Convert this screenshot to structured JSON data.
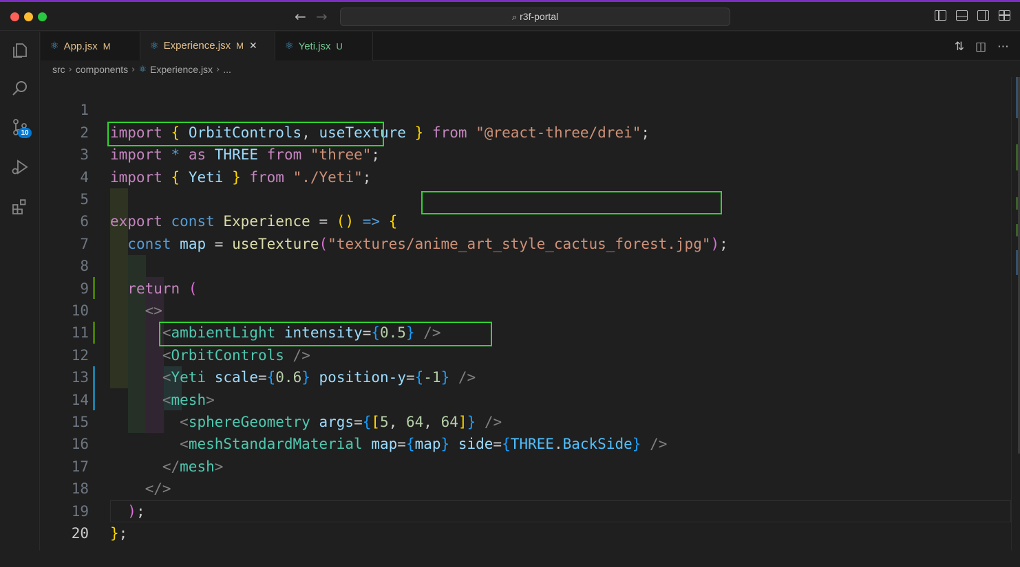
{
  "window": {
    "title": "r3f-portal"
  },
  "activity_bar": {
    "items": [
      "explorer-icon",
      "search-icon",
      "source-control-icon",
      "run-debug-icon",
      "extensions-icon"
    ],
    "source_control_badge": "10"
  },
  "tabs": [
    {
      "label": "App.jsx",
      "status": "M"
    },
    {
      "label": "Experience.jsx",
      "status": "M",
      "close": "✕"
    },
    {
      "label": "Yeti.jsx",
      "status": "U"
    }
  ],
  "breadcrumbs": {
    "items": [
      "src",
      "components",
      "Experience.jsx",
      "..."
    ]
  },
  "editor": {
    "language": "jsx",
    "current_line": 20,
    "line_numbers": [
      "1",
      "2",
      "3",
      "4",
      "5",
      "6",
      "7",
      "8",
      "9",
      "10",
      "11",
      "12",
      "13",
      "14",
      "15",
      "16",
      "17",
      "18",
      "19",
      "20"
    ],
    "lines": [
      "import { OrbitControls, useTexture } from \"@react-three/drei\";",
      "import * as THREE from \"three\";",
      "import { Yeti } from \"./Yeti\";",
      "",
      "export const Experience = () => {",
      "  const map = useTexture(\"textures/anime_art_style_cactus_forest.jpg\");",
      "",
      "  return (",
      "    <>",
      "      <ambientLight intensity={0.5} />",
      "      <OrbitControls />",
      "      <Yeti scale={0.6} position-y={-1} />",
      "      <mesh>",
      "        <sphereGeometry args={[5, 64, 64]} />",
      "        <meshStandardMaterial map={map} side={THREE.BackSide} />",
      "      </mesh>",
      "    </>",
      "  );",
      "};",
      ""
    ]
  },
  "tokens": {
    "l1": [
      "import",
      "{",
      "OrbitControls",
      ",",
      "useTexture",
      "}",
      "from",
      "\"@react-three/drei\"",
      ";"
    ],
    "l2": [
      "import",
      "*",
      "as",
      "THREE",
      "from",
      "\"three\"",
      ";"
    ],
    "l3": [
      "import",
      "{",
      "Yeti",
      "}",
      "from",
      "\"./Yeti\"",
      ";"
    ],
    "l5": [
      "export",
      "const",
      "Experience",
      "=",
      "(",
      ")",
      "=>",
      "{"
    ],
    "l6": [
      "const",
      "map",
      "=",
      "useTexture",
      "(",
      "\"textures/",
      "anime_art_style_cactus_forest.jpg",
      "\"",
      ")",
      ";"
    ],
    "l8": [
      "return",
      "("
    ],
    "l9": [
      "<>"
    ],
    "l10": [
      "<",
      "ambientLight",
      "intensity",
      "=",
      "{",
      "0.5",
      "}",
      "/>"
    ],
    "l11": [
      "<",
      "OrbitControls",
      "/>"
    ],
    "l12": [
      "<",
      "Yeti",
      "scale",
      "=",
      "{",
      "0.6",
      "}",
      "position-y",
      "=",
      "{",
      "-1",
      "}",
      "/>"
    ],
    "l13": [
      "<",
      "mesh",
      ">"
    ],
    "l14": [
      "<",
      "sphereGeometry",
      "args",
      "=",
      "{",
      "[",
      "5",
      ",",
      "64",
      ",",
      "64",
      "]",
      "}",
      "/>"
    ],
    "l15": [
      "<",
      "meshStandardMaterial",
      "map",
      "=",
      "{",
      "map",
      "}",
      "side",
      "=",
      "{",
      "THREE",
      ".",
      "BackSide",
      "}",
      "/>"
    ],
    "l16": [
      "</",
      "mesh",
      ">"
    ],
    "l17": [
      "</>"
    ],
    "l18": [
      ")",
      ";"
    ],
    "l19": [
      "}",
      ";"
    ]
  },
  "annotations": {
    "highlight_color": "#2fd52f",
    "highlighted_lines": [
      3,
      6,
      12
    ]
  },
  "colors": {
    "keyword_control": "#c586c0",
    "keyword_storage": "#569cd6",
    "variable": "#9cdcfe",
    "function": "#dcdcaa",
    "string": "#ce9178",
    "number": "#b5cea8",
    "component": "#4ec9b0",
    "modified": "#e2c08d",
    "untracked": "#73c991",
    "accent": "#0078d4"
  }
}
